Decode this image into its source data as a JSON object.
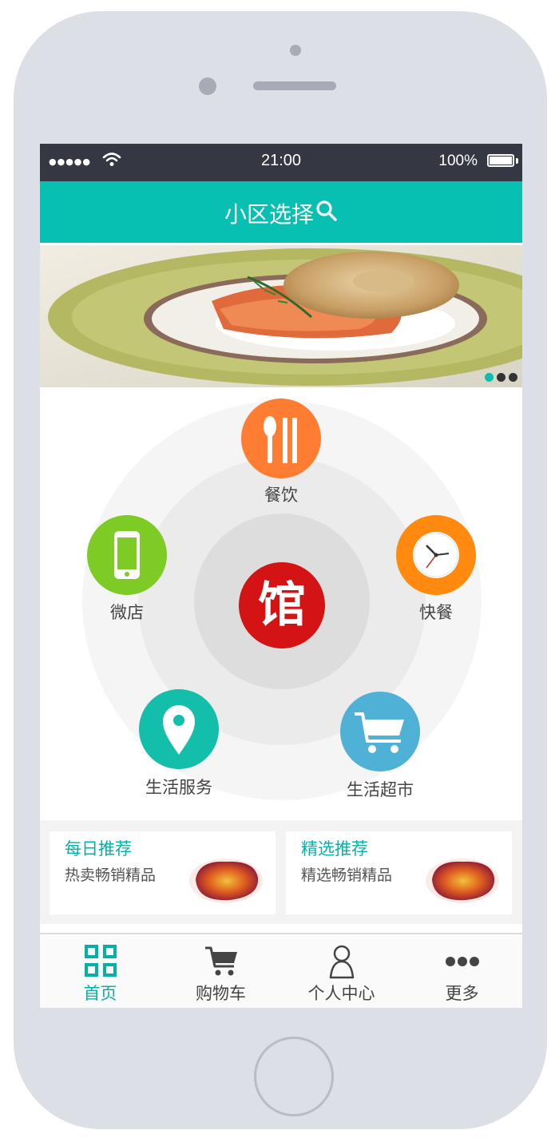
{
  "status_bar": {
    "time": "21:00",
    "battery": "100%",
    "signal": "●●●●●"
  },
  "header": {
    "title": "小区选择"
  },
  "banner": {
    "slide_count": 3,
    "active_slide": 1
  },
  "hub": {
    "center_label": "馆",
    "categories": [
      {
        "label": "餐饮",
        "icon": "utensils-icon",
        "color": "#ff7d33"
      },
      {
        "label": "快餐",
        "icon": "clock-icon",
        "color": "#ff8a0f"
      },
      {
        "label": "生活超市",
        "icon": "cart-icon",
        "color": "#4fb1d6"
      },
      {
        "label": "生活服务",
        "icon": "location-pin-icon",
        "color": "#13bfaa"
      },
      {
        "label": "微店",
        "icon": "phone-icon",
        "color": "#7ecb26"
      }
    ]
  },
  "recommendations": [
    {
      "title": "每日推荐",
      "subtitle": "热卖畅销精品"
    },
    {
      "title": "精选推荐",
      "subtitle": "精选畅销精品"
    }
  ],
  "tabs": [
    {
      "label": "首页",
      "icon": "grid-icon",
      "active": true
    },
    {
      "label": "购物车",
      "icon": "cart-icon",
      "active": false
    },
    {
      "label": "个人中心",
      "icon": "user-icon",
      "active": false
    },
    {
      "label": "更多",
      "icon": "more-icon",
      "active": false
    }
  ],
  "colors": {
    "accent": "#07c0b1",
    "status_bar": "#353743",
    "center_logo": "#d41414"
  }
}
